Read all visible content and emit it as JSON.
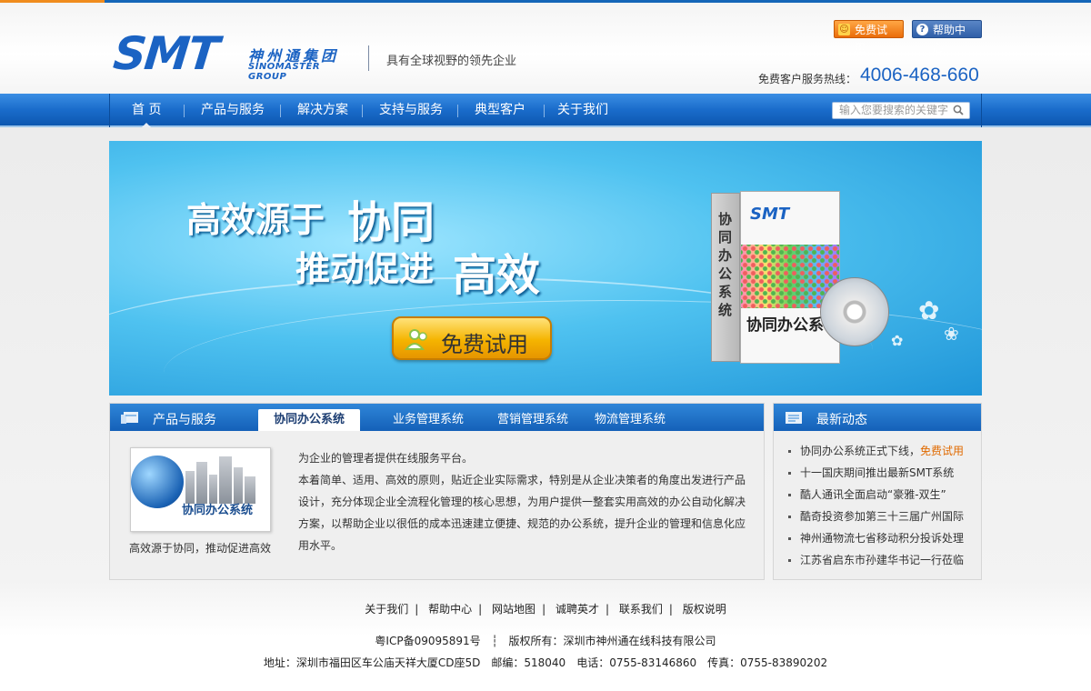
{
  "header": {
    "logo_text": "SMT",
    "logo_cn": "神州通集团",
    "logo_en": "SINOMASTER GROUP",
    "slogan": "具有全球视野的领先企业",
    "trial_button": "免费试用",
    "help_button": "帮助中心",
    "hotline_label": "免费客户服务热线：",
    "hotline_number": "4006-468-660"
  },
  "nav": {
    "items": [
      "首 页",
      "产品与服务",
      "解决方案",
      "支持与服务",
      "典型客户",
      "关于我们"
    ],
    "search_placeholder": "输入您要搜索的关键字"
  },
  "banner": {
    "line1_prefix": "高效源于",
    "line1_highlight": "协同",
    "line2_prefix": "推动促进",
    "line2_highlight": "高效",
    "trial_label": "免费试用",
    "box_logo": "SMT",
    "box_side": "协同办公系统",
    "box_name": "协同办公系"
  },
  "products": {
    "title": "产品与服务",
    "tabs": [
      "协同办公系统",
      "业务管理系统",
      "营销管理系统",
      "物流管理系统"
    ],
    "active_tab": 0,
    "image_label": "协同办公系统",
    "caption": "高效源于协同，推动促进高效",
    "intro": "为企业的管理者提供在线服务平台。",
    "description": "本着简单、适用、高效的原则，贴近企业实际需求，特别是从企业决策者的角度出发进行产品设计，充分体现企业全流程化管理的核心思想，为用户提供一整套实用高效的办公自动化解决方案，以帮助企业以很低的成本迅速建立便捷、规范的办公系统，提升企业的管理和信息化应用水平。"
  },
  "news": {
    "title": "最新动态",
    "items": [
      {
        "text": "协同办公系统正式下线，",
        "link": "免费试用"
      },
      {
        "text": "十一国庆期间推出最新SMT系统",
        "link": ""
      },
      {
        "text": "酷人通讯全面启动“豪雅-双生”",
        "link": ""
      },
      {
        "text": "酷奇投资参加第三十三届广州国际",
        "link": ""
      },
      {
        "text": "神州通物流七省移动积分投诉处理",
        "link": ""
      },
      {
        "text": "江苏省启东市孙建华书记一行莅临",
        "link": ""
      }
    ]
  },
  "footer": {
    "links": [
      "关于我们",
      "帮助中心",
      "网站地图",
      "诚聘英才",
      "联系我们",
      "版权说明"
    ],
    "icp": "粤ICP备09095891号",
    "copyright": "版权所有：深圳市神州通在线科技有限公司",
    "address": "地址：深圳市福田区车公庙天祥大厦CD座5D　邮编：518040　电话：0755-83146860　传真：0755-83890202"
  },
  "colors": {
    "brand_blue": "#1b63c3",
    "nav_blue": "#1a6ccb",
    "accent_orange": "#e06a00"
  }
}
